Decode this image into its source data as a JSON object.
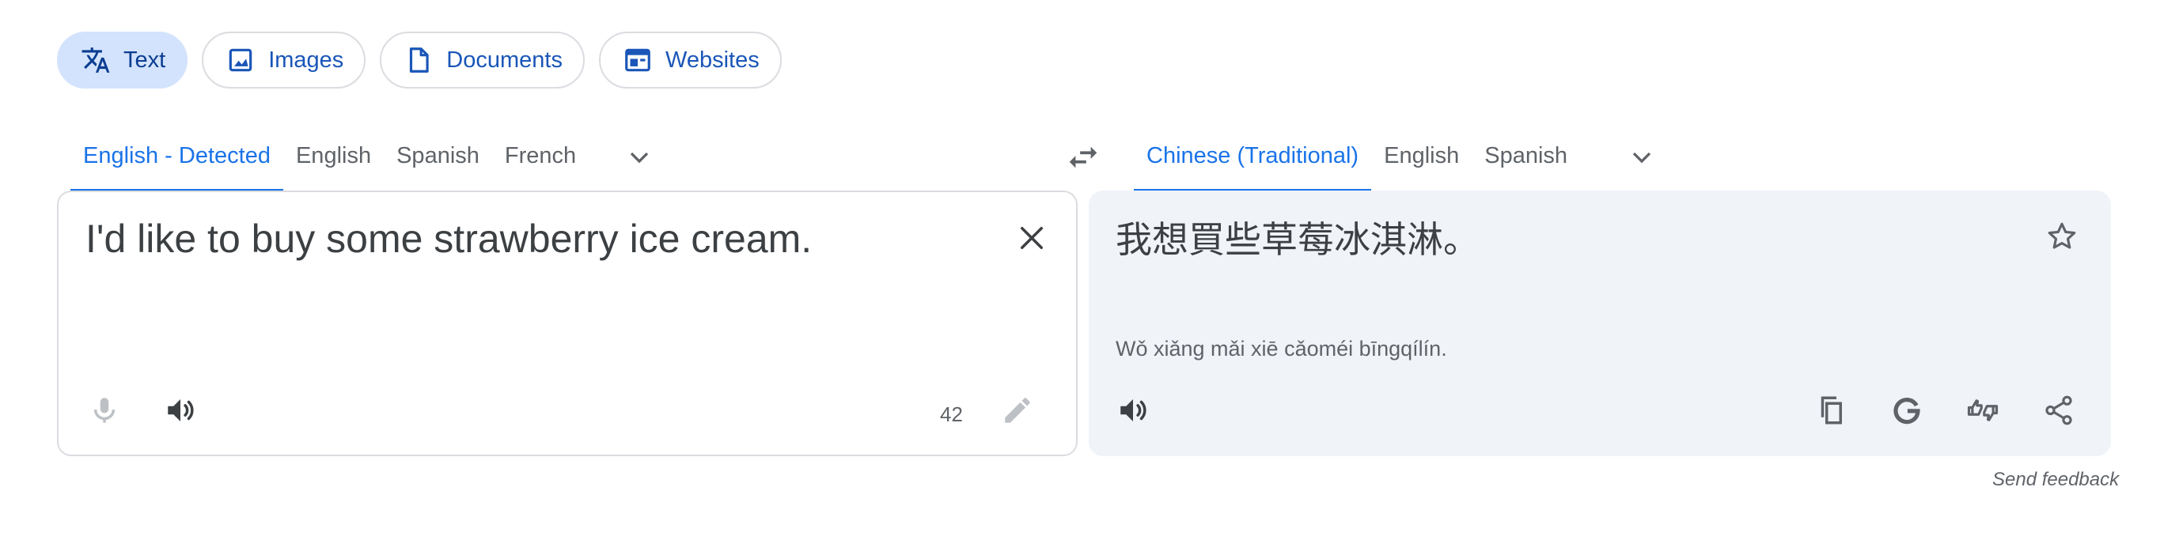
{
  "modes": [
    {
      "label": "Text",
      "icon": "translate-icon",
      "active": true
    },
    {
      "label": "Images",
      "icon": "image-icon",
      "active": false
    },
    {
      "label": "Documents",
      "icon": "document-icon",
      "active": false
    },
    {
      "label": "Websites",
      "icon": "website-icon",
      "active": false
    }
  ],
  "source": {
    "languages": [
      "English - Detected",
      "English",
      "Spanish",
      "French"
    ],
    "active_index": 0,
    "text": "I'd like to buy some strawberry ice cream.",
    "char_count": "42"
  },
  "target": {
    "languages": [
      "Chinese (Traditional)",
      "English",
      "Spanish"
    ],
    "active_index": 0,
    "text": "我想買些草莓冰淇淋。",
    "transliteration": "Wǒ xiǎng mǎi xiē cǎoméi bīngqílín."
  },
  "footer": {
    "feedback": "Send feedback"
  },
  "colors": {
    "accent": "#1a73e8",
    "chip_active_bg": "#d3e3fd",
    "target_panel_bg": "#f0f3f8",
    "icon": "#5f6368"
  }
}
